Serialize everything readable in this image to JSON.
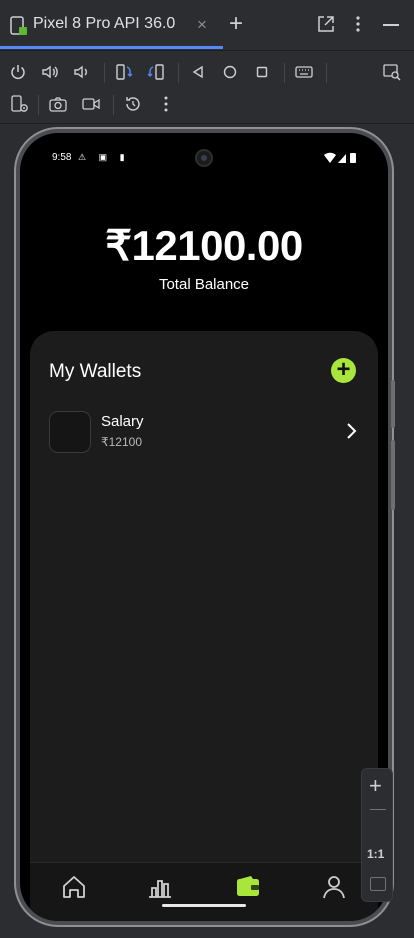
{
  "ide": {
    "tab_title": "Pixel 8 Pro API 36.0",
    "tab_close": "×",
    "new_tab": "+",
    "zoom": {
      "plus": "+",
      "one_to_one": "1:1"
    }
  },
  "toolbar_icons": [
    "power-icon",
    "volume-up-icon",
    "volume-down-icon",
    "rotate-left-icon",
    "rotate-right-icon",
    "back-icon",
    "home-icon",
    "overview-icon",
    "keyboard-icon",
    "search-window-icon",
    "device-settings-icon",
    "camera-icon",
    "video-icon",
    "reset-icon",
    "more-icon"
  ],
  "phone": {
    "status": {
      "time": "9:58",
      "left_icons": "⚠ ▣ ▮"
    },
    "balance": "₹12100.00",
    "balance_label": "Total Balance",
    "wallets_title": "My Wallets",
    "add_button": "+",
    "wallets": [
      {
        "name": "Salary",
        "amount": "₹12100"
      }
    ],
    "nav": [
      "home-icon",
      "chart-icon",
      "wallet-icon",
      "profile-icon"
    ],
    "active_nav": "wallet-icon"
  },
  "colors": {
    "accent": "#a8e63b",
    "ide_blue": "#548af7",
    "ide_bg": "#2b2d30"
  }
}
